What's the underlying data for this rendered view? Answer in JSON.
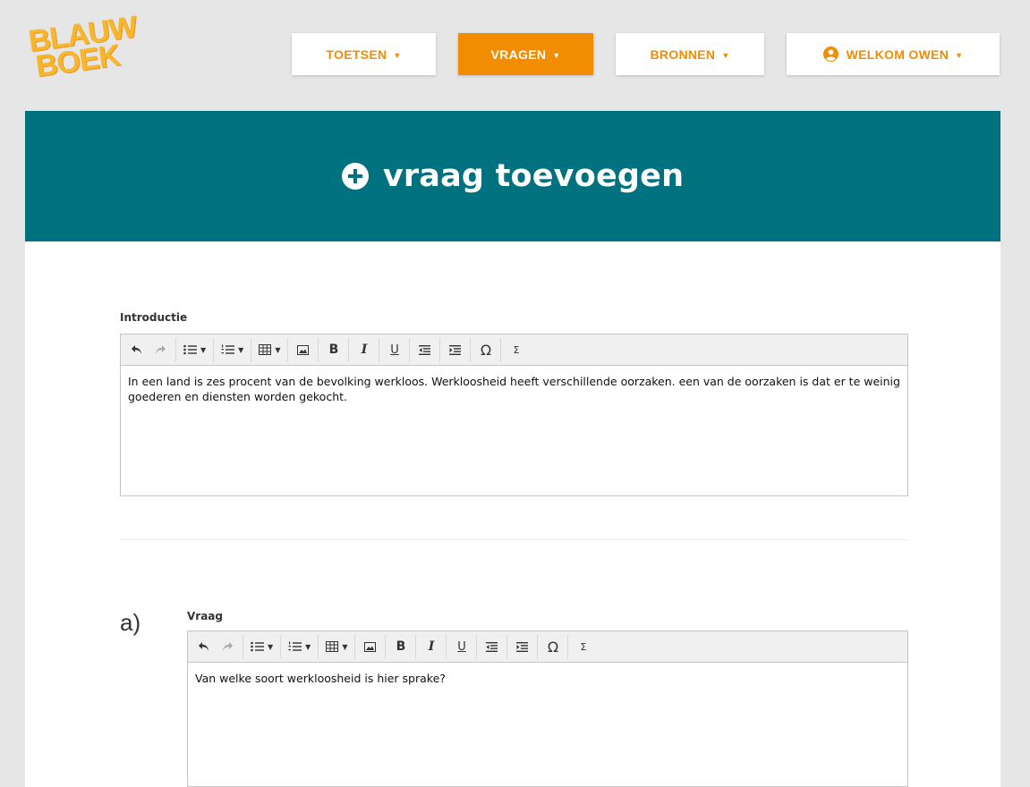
{
  "logo": {
    "line1": "BLAUW",
    "line2": "BOEK"
  },
  "nav": {
    "items": [
      {
        "label": "TOETSEN",
        "active": false
      },
      {
        "label": "VRAGEN",
        "active": true
      },
      {
        "label": "BRONNEN",
        "active": false
      },
      {
        "label": "WELKOM OWEN",
        "active": false
      }
    ]
  },
  "hero": {
    "title": "vraag toevoegen"
  },
  "intro": {
    "label": "Introductie",
    "text": "In een land is zes procent van de bevolking werkloos. Werkloosheid heeft verschillende oorzaken. een van de oorzaken is dat er te weinig goederen en diensten worden gekocht."
  },
  "question": {
    "letter": "a)",
    "label": "Vraag",
    "text": "Van welke soort werkloosheid is hier sprake?"
  },
  "toolbar": {
    "bold": "B",
    "italic": "I",
    "underline": "U",
    "omega": "Ω",
    "sigma": "Σ"
  },
  "colors": {
    "accent": "#f28c00",
    "teal": "#00717f",
    "logo": "#f7b62c"
  }
}
